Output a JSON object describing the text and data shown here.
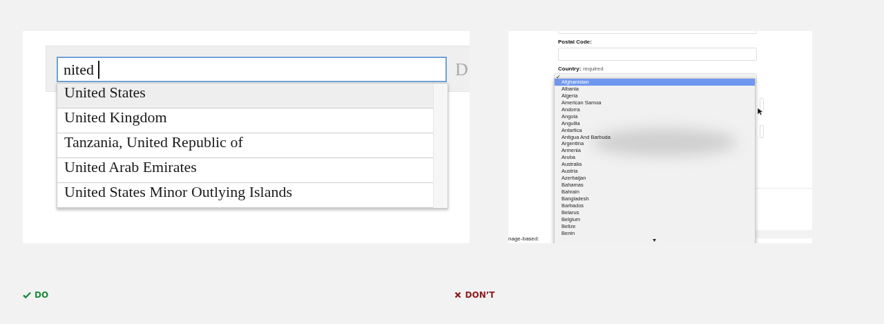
{
  "do_example": {
    "search_field": {
      "value": "nited"
    },
    "next_label": "D",
    "suggestions": [
      {
        "label": "United States",
        "selected": true
      },
      {
        "label": "United Kingdom",
        "selected": false
      },
      {
        "label": "Tanzania, United Republic of",
        "selected": false
      },
      {
        "label": "United Arab Emirates",
        "selected": false
      },
      {
        "label": "United States Minor Outlying Islands",
        "selected": false
      }
    ]
  },
  "dont_example": {
    "postal_label": "Postal Code:",
    "country_label": "Country:",
    "country_hint": "required",
    "check": "✓",
    "options": [
      {
        "label": "Afghanistan",
        "selected": true
      },
      {
        "label": "Albania",
        "selected": false
      },
      {
        "label": "Algeria",
        "selected": false
      },
      {
        "label": "American Samoa",
        "selected": false
      },
      {
        "label": "Andorra",
        "selected": false
      },
      {
        "label": "Angola",
        "selected": false
      },
      {
        "label": "Anguilla",
        "selected": false
      },
      {
        "label": "Antartica",
        "selected": false
      },
      {
        "label": "Antigua And Barbuda",
        "selected": false
      },
      {
        "label": "Argentina",
        "selected": false
      },
      {
        "label": "Armenia",
        "selected": false
      },
      {
        "label": "Aruba",
        "selected": false
      },
      {
        "label": "Australia",
        "selected": false
      },
      {
        "label": "Austria",
        "selected": false
      },
      {
        "label": "Azerbaijan",
        "selected": false
      },
      {
        "label": "Bahamas",
        "selected": false
      },
      {
        "label": "Bahrain",
        "selected": false
      },
      {
        "label": "Bangladesh",
        "selected": false
      },
      {
        "label": "Barbados",
        "selected": false
      },
      {
        "label": "Belarus",
        "selected": false
      },
      {
        "label": "Belgium",
        "selected": false
      },
      {
        "label": "Belize",
        "selected": false
      },
      {
        "label": "Benin",
        "selected": false
      }
    ],
    "footer_text": "nage-based:"
  },
  "captions": [
    {
      "kind": "do",
      "label": "DO"
    },
    {
      "kind": "dont",
      "label": "DON’T"
    }
  ]
}
